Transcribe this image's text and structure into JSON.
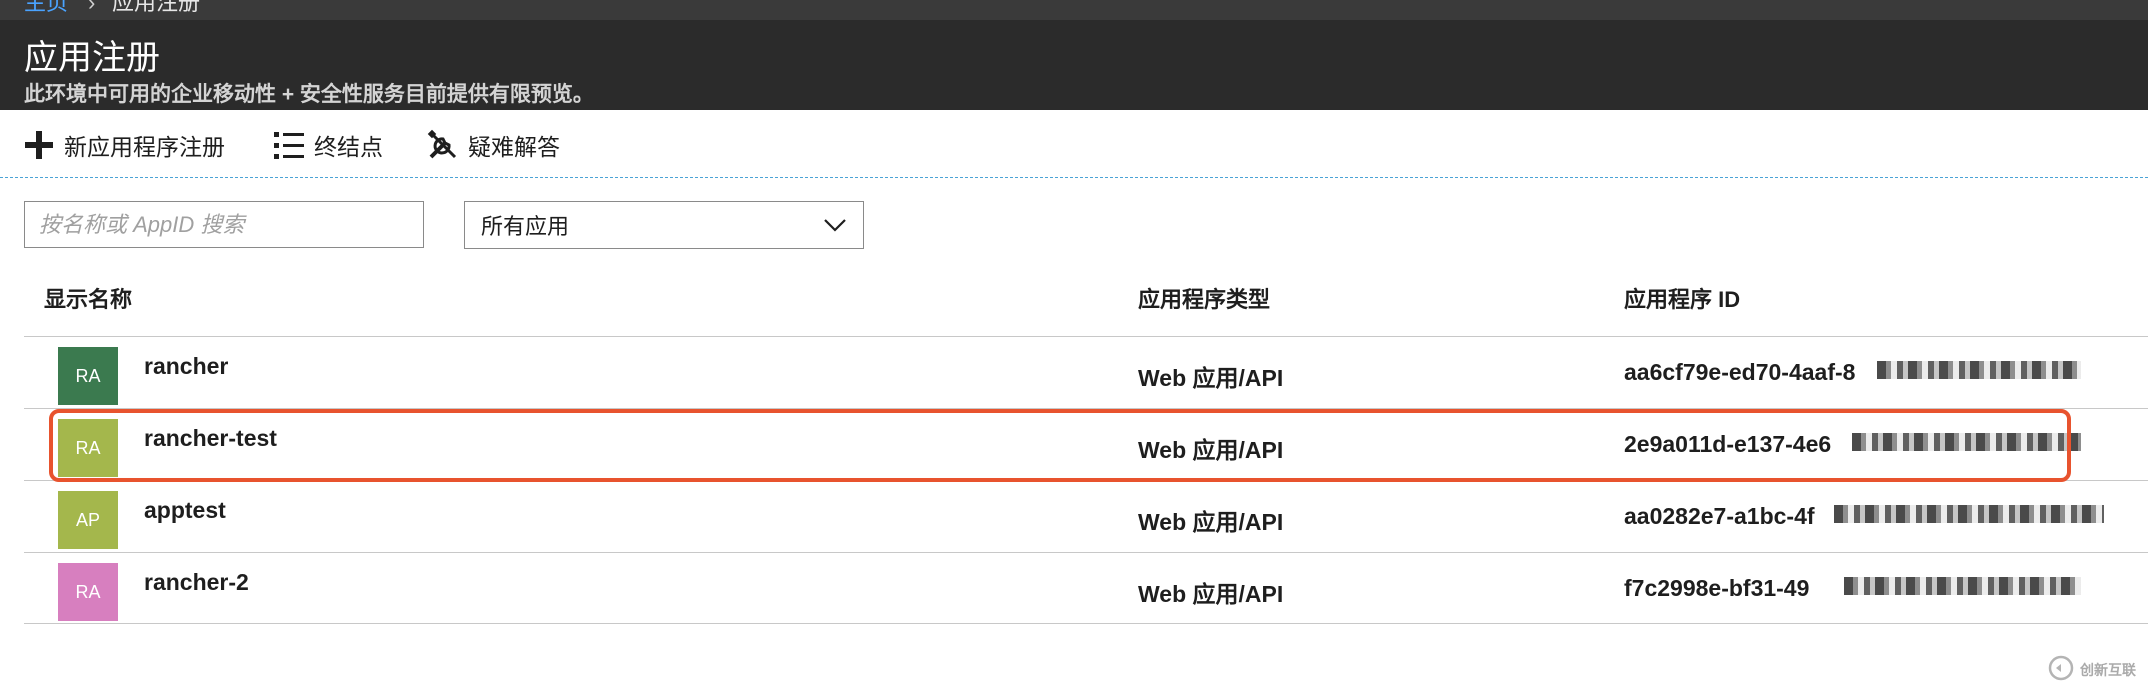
{
  "breadcrumb": {
    "home": "主页",
    "separator": "›",
    "current": "应用注册"
  },
  "header": {
    "title": "应用注册",
    "subtitle": "此环境中可用的企业移动性 + 安全性服务目前提供有限预览。"
  },
  "toolbar": {
    "new_registration": "新应用程序注册",
    "endpoints": "终结点",
    "troubleshoot": "疑难解答"
  },
  "filters": {
    "search_placeholder": "按名称或 AppID 搜索",
    "app_filter_value": "所有应用"
  },
  "table": {
    "columns": [
      "显示名称",
      "应用程序类型",
      "应用程序 ID"
    ],
    "rows": [
      {
        "initials": "RA",
        "avatar_color": "#3b7a4f",
        "name": "rancher",
        "type": "Web 应用/API",
        "id": "aa6cf79e-ed70-4aaf-8"
      },
      {
        "initials": "RA",
        "avatar_color": "#a4b74c",
        "name": "rancher-test",
        "type": "Web 应用/API",
        "id": "2e9a011d-e137-4e6"
      },
      {
        "initials": "AP",
        "avatar_color": "#a4b74c",
        "name": "apptest",
        "type": "Web 应用/API",
        "id": "aa0282e7-a1bc-4f"
      },
      {
        "initials": "RA",
        "avatar_color": "#d77fbf",
        "name": "rancher-2",
        "type": "Web 应用/API",
        "id": "f7c2998e-bf31-49"
      }
    ]
  },
  "highlight_color": "#e8532e",
  "watermark": {
    "text": "创新互联"
  }
}
